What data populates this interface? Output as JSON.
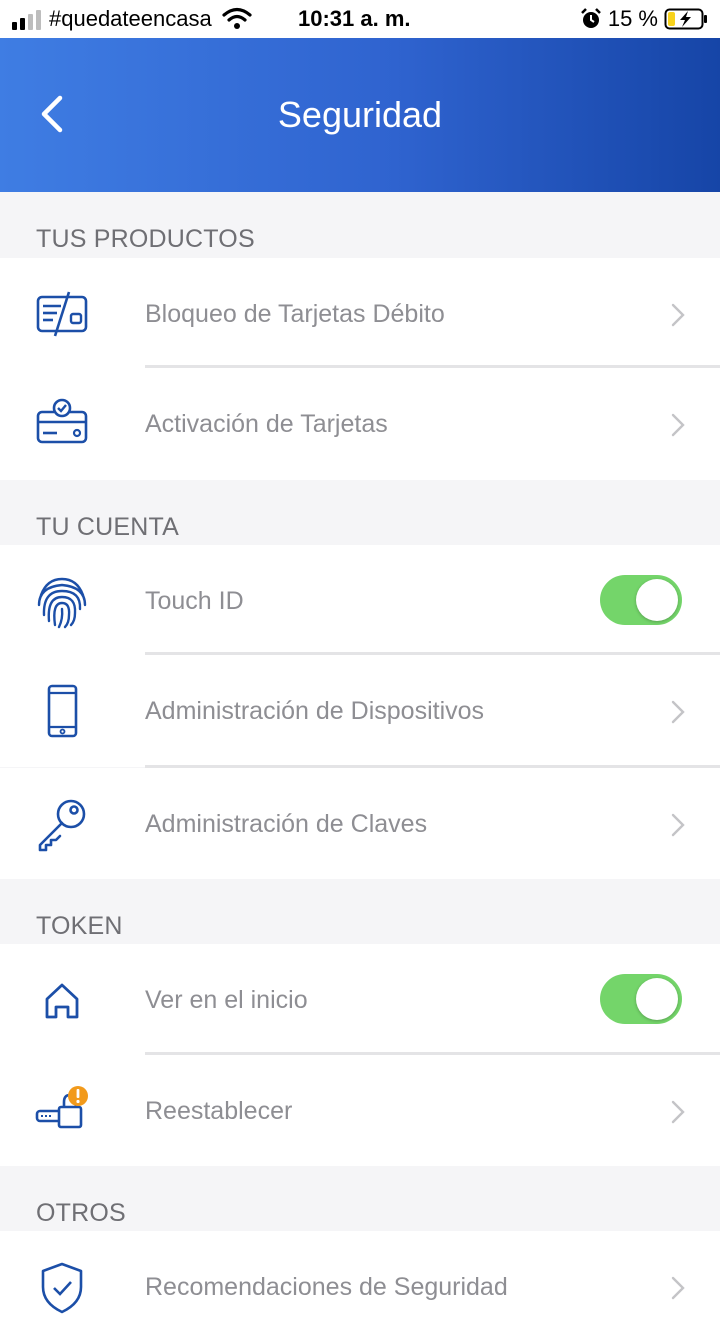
{
  "status_bar": {
    "carrier": "#quedateencasa",
    "time": "10:31 a. m.",
    "battery": "15 %"
  },
  "header": {
    "title": "Seguridad"
  },
  "sections": [
    {
      "title": "TUS PRODUCTOS",
      "items": [
        {
          "label": "Bloqueo de Tarjetas Débito",
          "icon": "card-block-icon",
          "control": "chevron"
        },
        {
          "label": "Activación de Tarjetas",
          "icon": "card-activation-icon",
          "control": "chevron"
        }
      ]
    },
    {
      "title": "TU CUENTA",
      "items": [
        {
          "label": "Touch ID",
          "icon": "fingerprint-icon",
          "control": "toggle",
          "enabled": true
        },
        {
          "label": "Administración de Dispositivos",
          "icon": "phone-icon",
          "control": "chevron"
        },
        {
          "label": "Administración de Claves",
          "icon": "key-icon",
          "control": "chevron"
        }
      ]
    },
    {
      "title": "TOKEN",
      "items": [
        {
          "label": "Ver en el inicio",
          "icon": "home-icon",
          "control": "toggle",
          "enabled": true
        },
        {
          "label": "Reestablecer",
          "icon": "token-reset-icon",
          "control": "chevron"
        }
      ]
    },
    {
      "title": "OTROS",
      "items": [
        {
          "label": "Recomendaciones de Seguridad",
          "icon": "shield-icon",
          "control": "chevron"
        }
      ]
    }
  ],
  "colors": {
    "header_gradient_start": "#3f7de3",
    "header_gradient_end": "#1645a7",
    "toggle_on": "#74d56a",
    "icon_blue": "#1c4fa8",
    "alert_orange": "#f29a1b"
  }
}
